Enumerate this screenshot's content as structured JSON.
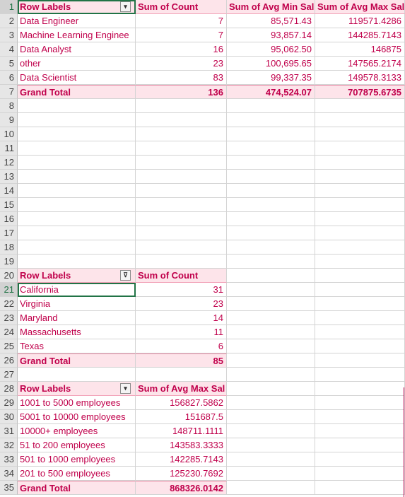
{
  "rows": [
    "1",
    "2",
    "3",
    "4",
    "5",
    "6",
    "7",
    "8",
    "9",
    "10",
    "11",
    "12",
    "13",
    "14",
    "15",
    "16",
    "17",
    "18",
    "19",
    "20",
    "21",
    "22",
    "23",
    "24",
    "25",
    "26",
    "27",
    "28",
    "29",
    "30",
    "31",
    "32",
    "33",
    "34",
    "35"
  ],
  "pivot1": {
    "headers": [
      "Row Labels",
      "Sum of Count",
      "Sum of Avg Min Sal",
      "Sum of Avg Max Sal"
    ],
    "rows": [
      [
        "Data Engineer",
        "7",
        "85,571.43",
        "119571.4286"
      ],
      [
        "Machine Learning Enginee",
        "7",
        "93,857.14",
        "144285.7143"
      ],
      [
        "Data Analyst",
        "16",
        "95,062.50",
        "146875"
      ],
      [
        "other",
        "23",
        "100,695.65",
        "147565.2174"
      ],
      [
        "Data Scientist",
        "83",
        "99,337.35",
        "149578.3133"
      ]
    ],
    "total": [
      "Grand Total",
      "136",
      "474,524.07",
      "707875.6735"
    ]
  },
  "pivot2": {
    "headers": [
      "Row Labels",
      "Sum of Count"
    ],
    "rows": [
      [
        "California",
        "31"
      ],
      [
        "Virginia",
        "23"
      ],
      [
        "Maryland",
        "14"
      ],
      [
        "Massachusetts",
        "11"
      ],
      [
        "Texas",
        "6"
      ]
    ],
    "total": [
      "Grand Total",
      "85"
    ]
  },
  "pivot3": {
    "headers": [
      "Row Labels",
      "Sum of Avg Max Sal"
    ],
    "rows": [
      [
        "1001 to 5000 employees",
        "156827.5862"
      ],
      [
        "5001 to 10000 employees",
        "151687.5"
      ],
      [
        "10000+ employees",
        "148711.1111"
      ],
      [
        "51 to 200 employees",
        "143583.3333"
      ],
      [
        "501 to 1000 employees",
        "142285.7143"
      ],
      [
        "201 to 500 employees",
        "125230.7692"
      ]
    ],
    "total": [
      "Grand Total",
      "868326.0142"
    ]
  },
  "icons": {
    "sort_filter": "sort-dropdown-icon",
    "filter_active": "filter-active-icon"
  },
  "colors": {
    "pivot_text": "#c0004b",
    "pivot_header_bg": "#fde4ea",
    "selection": "#217346"
  }
}
